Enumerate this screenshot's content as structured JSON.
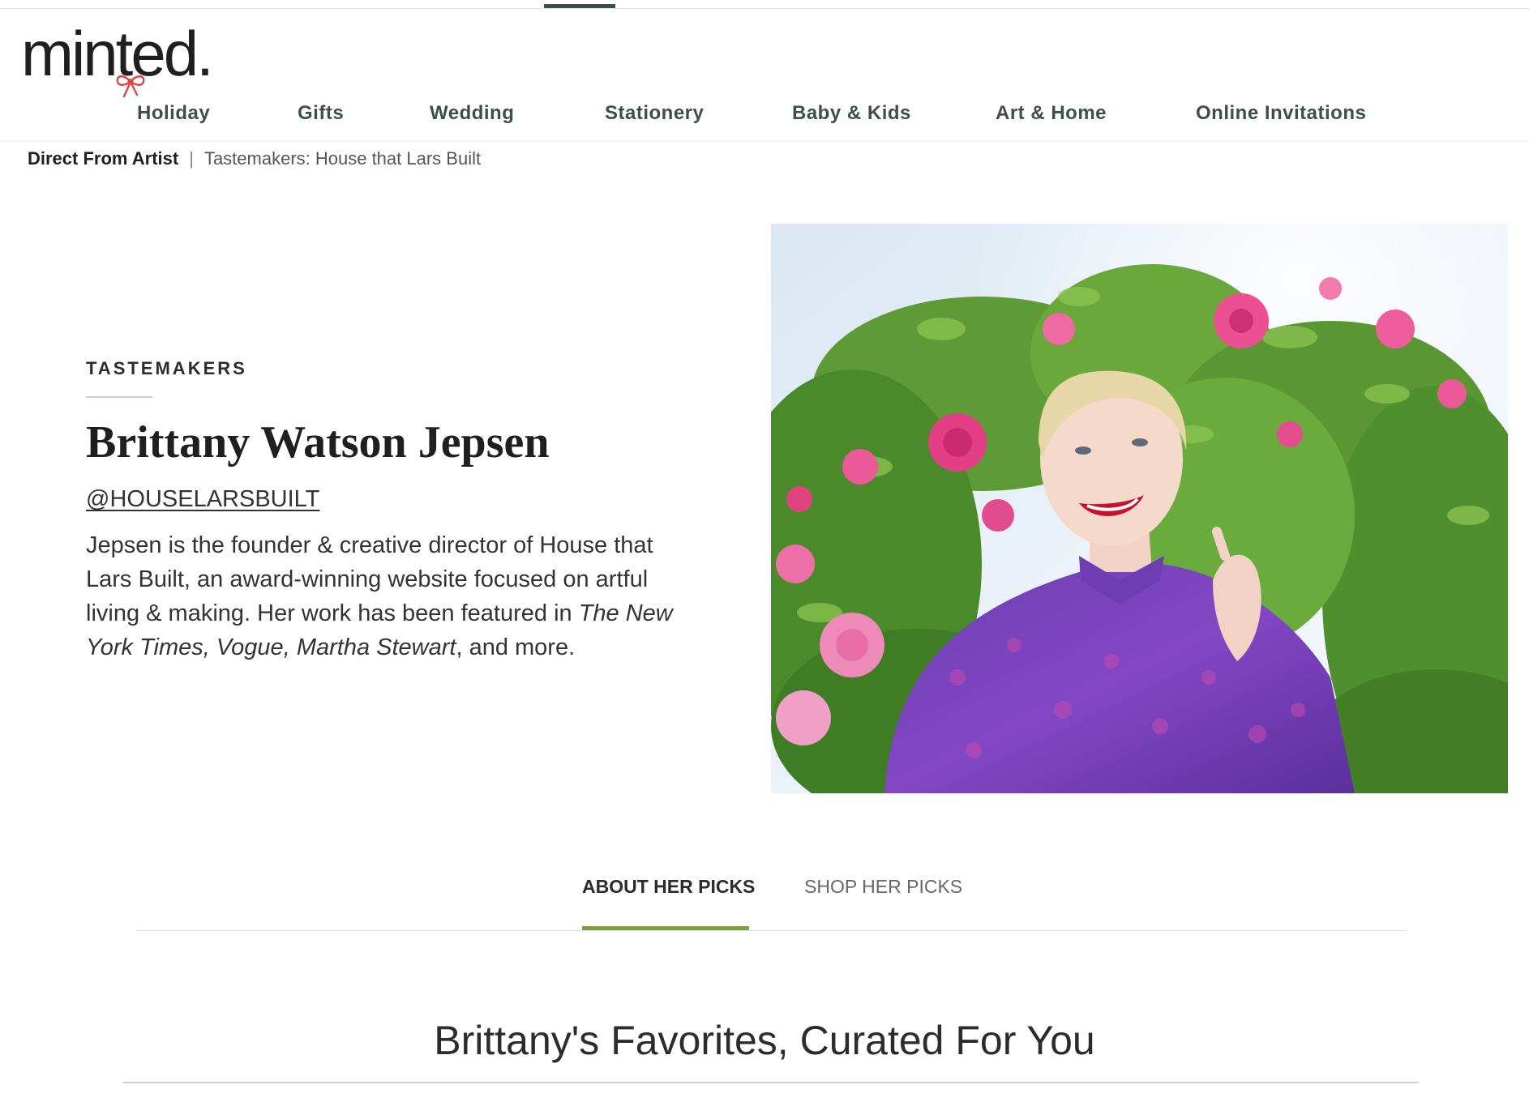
{
  "brand": {
    "logo": "minted."
  },
  "nav": {
    "items": [
      {
        "label": "Holiday"
      },
      {
        "label": "Gifts"
      },
      {
        "label": "Wedding"
      },
      {
        "label": "Stationery"
      },
      {
        "label": "Baby & Kids"
      },
      {
        "label": "Art & Home"
      },
      {
        "label": "Online Invitations"
      }
    ]
  },
  "breadcrumb": {
    "first": "Direct From Artist",
    "separator": "|",
    "current": "Tastemakers: House that Lars Built"
  },
  "hero": {
    "eyebrow": "TASTEMAKERS",
    "name": "Brittany Watson Jepsen",
    "handle": "@HOUSELARSBUILT",
    "bio_text": "Jepsen is the founder & creative director of House that Lars Built, an award-winning website focused on artful living & making. Her work has been featured in ",
    "bio_pub1": "The New York Times",
    "bio_sep1": ", ",
    "bio_pub2": "Vogue",
    "bio_sep2": ", ",
    "bio_pub3": "Martha Stewart",
    "bio_end": ", and more."
  },
  "tabs": {
    "about": "ABOUT HER PICKS",
    "shop": "SHOP HER PICKS"
  },
  "section": {
    "title": "Brittany's Favorites, Curated For You"
  },
  "colors": {
    "nav_text": "#3d4f4b",
    "tab_accent": "#7ba23f",
    "bow_red": "#e0434a"
  }
}
